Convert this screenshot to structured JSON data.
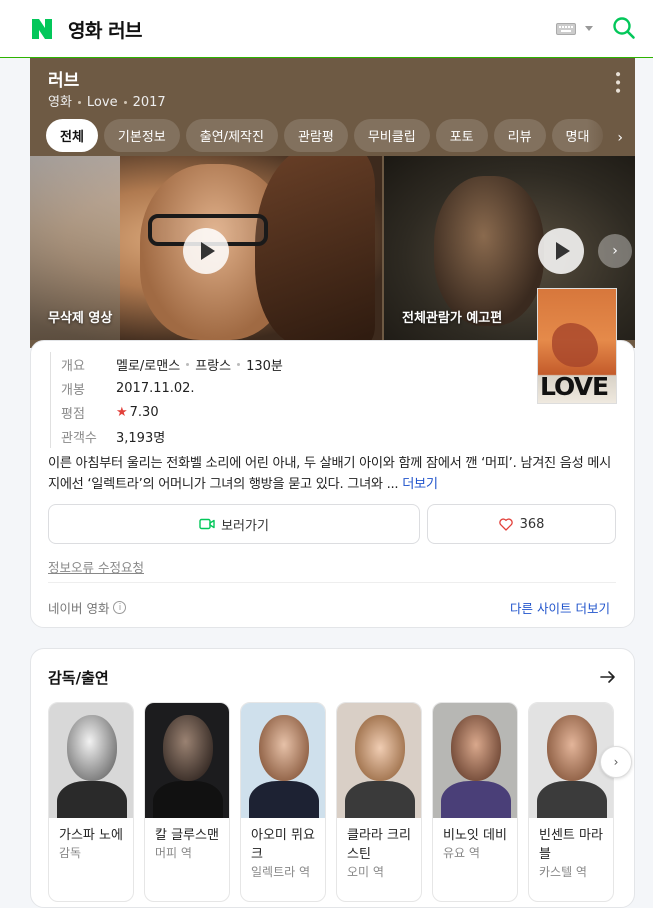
{
  "header": {
    "title": "영화 러브"
  },
  "hero": {
    "title": "러브",
    "meta": [
      "영화",
      "Love",
      "2017"
    ],
    "tabs": [
      "전체",
      "기본정보",
      "출연/제작진",
      "관람평",
      "무비클립",
      "포토",
      "리뷰",
      "명대"
    ],
    "clips": [
      {
        "label": "무삭제 영상"
      },
      {
        "label": "전체관람가 예고편"
      }
    ]
  },
  "info": {
    "poster_text": "LOVE",
    "rows": [
      {
        "key": "개요",
        "values": [
          "멜로/로맨스",
          "프랑스",
          "130분"
        ]
      },
      {
        "key": "개봉",
        "values": [
          "2017.11.02."
        ]
      },
      {
        "key": "평점",
        "values": [
          "7.30"
        ]
      },
      {
        "key": "관객수",
        "values": [
          "3,193명"
        ]
      }
    ],
    "synopsis": "이른 아침부터 울리는 전화벨 소리에 어린 아내, 두 살배기 아이와 함께 잠에서 깬 ‘머피’. 남겨진 음성 메시지에선 ‘일렉트라’의 어머니가 그녀의 행방을 묻고 있다. 그녀와 ... ",
    "more_label": "더보기",
    "watch_label": "보러가기",
    "like_count": "368",
    "report_label": "정보오류 수정요청",
    "source_label": "네이버 영화",
    "other_sites_label": "다른 사이트 더보기"
  },
  "cast": {
    "title": "감독/출연",
    "people": [
      {
        "name": "가스파 노에",
        "role": "감독"
      },
      {
        "name": "칼 글루스맨",
        "role": "머피 역"
      },
      {
        "name": "아오미 뮈요크",
        "role": "일렉트라 역"
      },
      {
        "name": "클라라 크리스틴",
        "role": "오미 역"
      },
      {
        "name": "비노잇 데비",
        "role": "유요 역"
      },
      {
        "name": "빈센트 마라블",
        "role": "카스텔 역"
      }
    ]
  },
  "colors": {
    "naver_green": "#03c75a",
    "accent_blue": "#2255cc",
    "hero_bg": "#6e5a44",
    "star_red": "#e2413b"
  }
}
